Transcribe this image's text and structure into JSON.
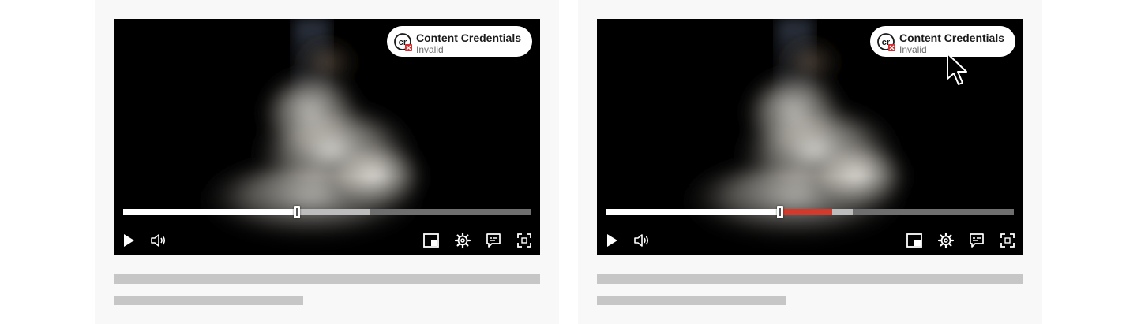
{
  "panels": [
    {
      "badge": {
        "title": "Content Credentials",
        "status": "Invalid"
      },
      "progress": {
        "played": 0.426,
        "invalid_end": null,
        "buffered": 0.605
      },
      "controls": [
        "play-icon",
        "volume-icon",
        "picture-in-picture-icon",
        "gear-icon",
        "captions-icon",
        "fullscreen-icon"
      ],
      "cursor_visible": false
    },
    {
      "badge": {
        "title": "Content Credentials",
        "status": "Invalid"
      },
      "progress": {
        "played": 0.426,
        "invalid_end": 0.555,
        "buffered": 0.605
      },
      "controls": [
        "play-icon",
        "volume-icon",
        "picture-in-picture-icon",
        "gear-icon",
        "captions-icon",
        "fullscreen-icon"
      ],
      "cursor_visible": true
    }
  ],
  "colors": {
    "invalid_segment": "#d33a2c",
    "error_badge": "#d32f2f",
    "skeleton": "#c6c6c6"
  }
}
